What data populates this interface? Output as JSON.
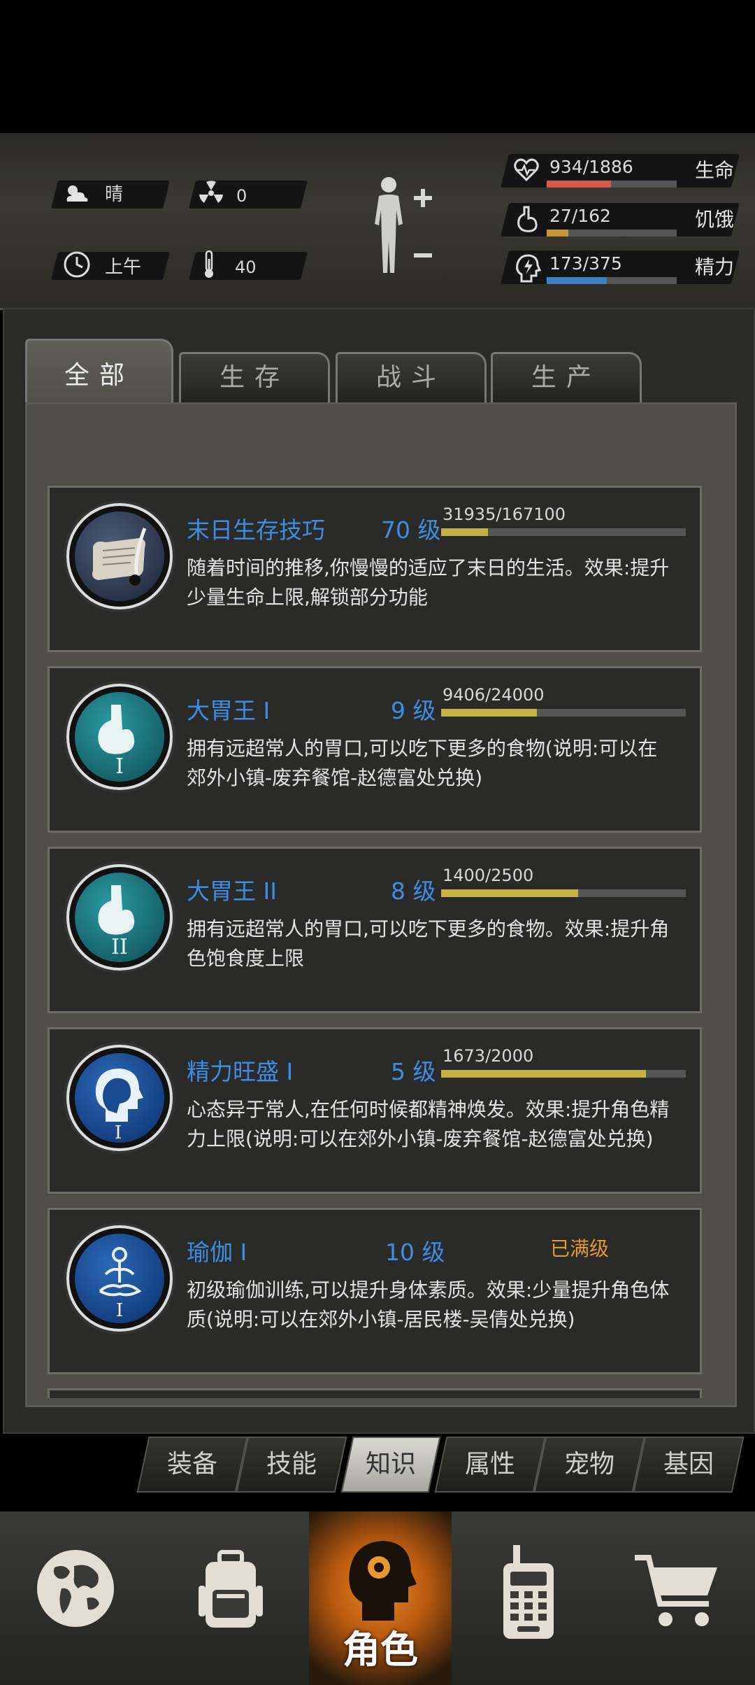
{
  "status": {
    "weather": "晴",
    "radiation": "0",
    "time_of_day": "上午",
    "temperature": "40",
    "stats": [
      {
        "name": "生命",
        "value": "934/1886",
        "fraction": 0.495,
        "color": "#d45a4a",
        "icon": "heart-pulse-icon"
      },
      {
        "name": "饥饿",
        "value": "27/162",
        "fraction": 0.167,
        "color": "#c9953c",
        "icon": "stomach-icon"
      },
      {
        "name": "精力",
        "value": "173/375",
        "fraction": 0.461,
        "color": "#3f7fc6",
        "icon": "head-bolt-icon"
      }
    ]
  },
  "tabs": [
    {
      "label": "全部",
      "active": true
    },
    {
      "label": "生存",
      "active": false
    },
    {
      "label": "战斗",
      "active": false
    },
    {
      "label": "生产",
      "active": false
    }
  ],
  "skills": [
    {
      "name": "末日生存技巧",
      "level": "70 级",
      "progress": "31935/167100",
      "fraction": 0.191,
      "desc": "随着时间的推移,你慢慢的适应了末日的生活。效果:提升少量生命上限,解锁部分功能",
      "icon": "scroll-quill-icon",
      "maxed": ""
    },
    {
      "name": "大胃王 I",
      "level": "9 级",
      "progress": "9406/24000",
      "fraction": 0.392,
      "desc": "拥有远超常人的胃口,可以吃下更多的食物(说明:可以在郊外小镇-废弃餐馆-赵德富处兑换)",
      "icon": "stomach-1-icon",
      "maxed": ""
    },
    {
      "name": "大胃王 II",
      "level": "8 级",
      "progress": "1400/2500",
      "fraction": 0.56,
      "desc": "拥有远超常人的胃口,可以吃下更多的食物。效果:提升角色饱食度上限",
      "icon": "stomach-2-icon",
      "maxed": ""
    },
    {
      "name": "精力旺盛 I",
      "level": "5 级",
      "progress": "1673/2000",
      "fraction": 0.837,
      "desc": "心态异于常人,在任何时候都精神焕发。效果:提升角色精力上限(说明:可以在郊外小镇-废弃餐馆-赵德富处兑换)",
      "icon": "head-1-icon",
      "maxed": ""
    },
    {
      "name": "瑜伽 I",
      "level": "10 级",
      "progress": "",
      "fraction": 0,
      "desc": "初级瑜伽训练,可以提升身体素质。效果:少量提升角色体质(说明:可以在郊外小镇-居民楼-吴倩处兑换)",
      "icon": "yoga-1-icon",
      "maxed": "已满级"
    }
  ],
  "subtabs": [
    {
      "label": "装备",
      "active": false
    },
    {
      "label": "技能",
      "active": false
    },
    {
      "label": "知识",
      "active": true
    },
    {
      "label": "属性",
      "active": false
    },
    {
      "label": "宠物",
      "active": false
    },
    {
      "label": "基因",
      "active": false
    }
  ],
  "nav": {
    "character_label": "角色"
  }
}
